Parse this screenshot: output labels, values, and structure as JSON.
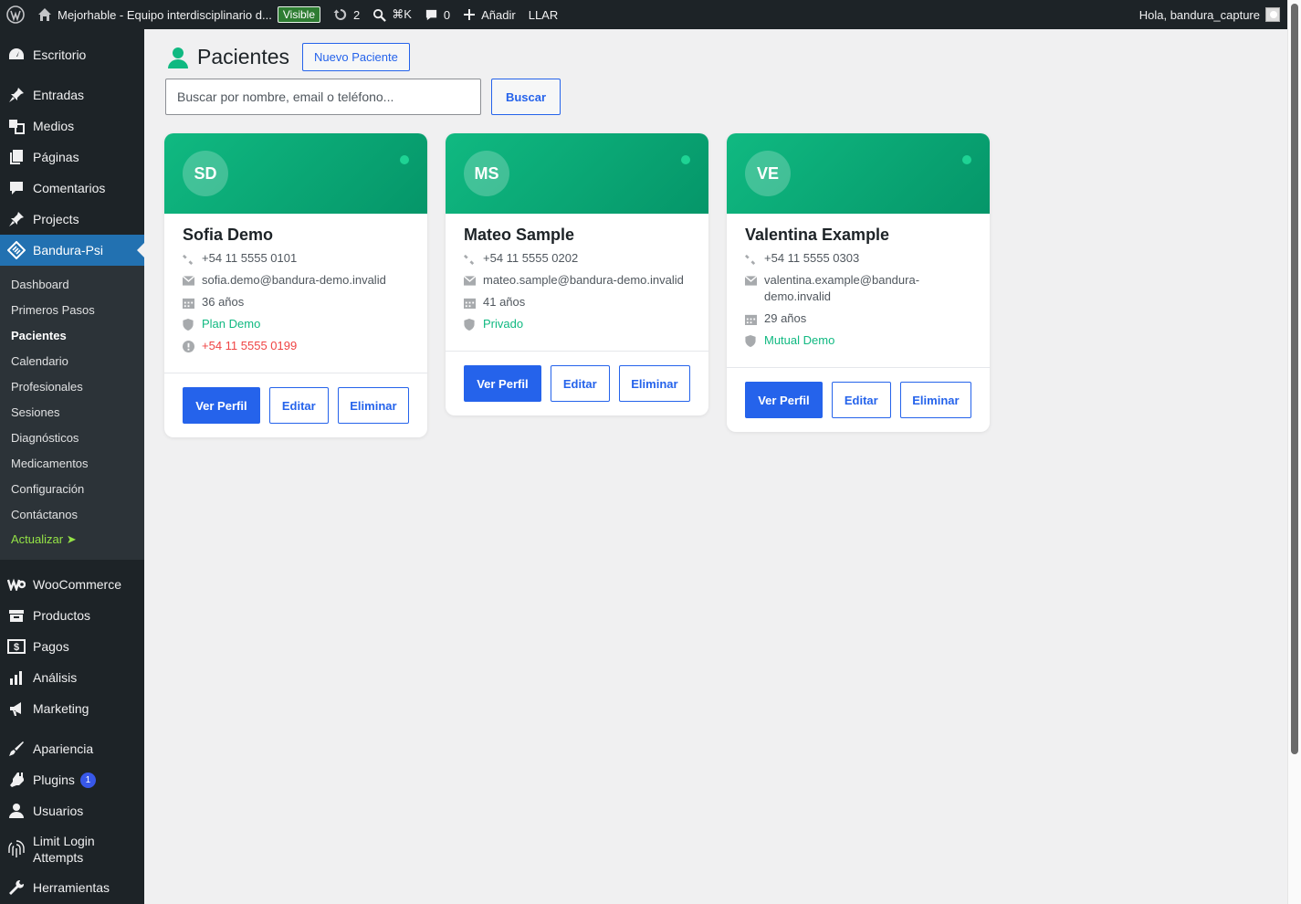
{
  "adminbar": {
    "site_name": "Mejorhable - Equipo interdisciplinario d...",
    "visible_badge": "Visible",
    "updates_count": "2",
    "search_shortcut": "⌘K",
    "comments_count": "0",
    "add_new": "Añadir",
    "llar": "LLAR",
    "greeting": "Hola, bandura_capture"
  },
  "sidebar": {
    "items_top": [
      {
        "label": "Escritorio",
        "icon": "dashboard-icon"
      },
      {
        "label": "Entradas",
        "icon": "pin-icon"
      },
      {
        "label": "Medios",
        "icon": "media-icon"
      },
      {
        "label": "Páginas",
        "icon": "pages-icon"
      },
      {
        "label": "Comentarios",
        "icon": "comment-icon"
      },
      {
        "label": "Projects",
        "icon": "pin-icon"
      },
      {
        "label": "Bandura-Psi",
        "icon": "diamond-icon"
      }
    ],
    "submenu": [
      "Dashboard",
      "Primeros Pasos",
      "Pacientes",
      "Calendario",
      "Profesionales",
      "Sesiones",
      "Diagnósticos",
      "Medicamentos",
      "Configuración",
      "Contáctanos",
      "Actualizar ➤"
    ],
    "items_bottom": [
      {
        "label": "WooCommerce",
        "icon": "woocommerce-icon"
      },
      {
        "label": "Productos",
        "icon": "archive-icon"
      },
      {
        "label": "Pagos",
        "icon": "dollar-icon"
      },
      {
        "label": "Análisis",
        "icon": "chart-bar-icon"
      },
      {
        "label": "Marketing",
        "icon": "megaphone-icon"
      },
      {
        "label": "Apariencia",
        "icon": "brush-icon"
      },
      {
        "label": "Plugins",
        "icon": "plugin-icon",
        "badge": "1"
      },
      {
        "label": "Usuarios",
        "icon": "user-icon"
      },
      {
        "label": "Limit Login Attempts",
        "icon": "fingerprint-icon"
      },
      {
        "label": "Herramientas",
        "icon": "wrench-icon"
      }
    ]
  },
  "page": {
    "title": "Pacientes",
    "new_button": "Nuevo Paciente",
    "search_placeholder": "Buscar por nombre, email o teléfono...",
    "search_button": "Buscar"
  },
  "patients": [
    {
      "initials": "SD",
      "name": "Sofia Demo",
      "phone": "+54 11 5555 0101",
      "email": "sofia.demo@bandura-demo.invalid",
      "age": "36 años",
      "plan": "Plan Demo",
      "emergency": "+54 11 5555 0199"
    },
    {
      "initials": "MS",
      "name": "Mateo Sample",
      "phone": "+54 11 5555 0202",
      "email": "mateo.sample@bandura-demo.invalid",
      "age": "41 años",
      "plan": "Privado"
    },
    {
      "initials": "VE",
      "name": "Valentina Example",
      "phone": "+54 11 5555 0303",
      "email": "valentina.example@bandura-demo.invalid",
      "age": "29 años",
      "plan": "Mutual Demo"
    }
  ],
  "card_actions": {
    "view": "Ver Perfil",
    "edit": "Editar",
    "delete": "Eliminar"
  },
  "colors": {
    "accent": "#2563eb",
    "card_header": "#10b981",
    "admin_dark": "#1d2327",
    "menu_current": "#2271b1",
    "emergency": "#ef4444"
  }
}
